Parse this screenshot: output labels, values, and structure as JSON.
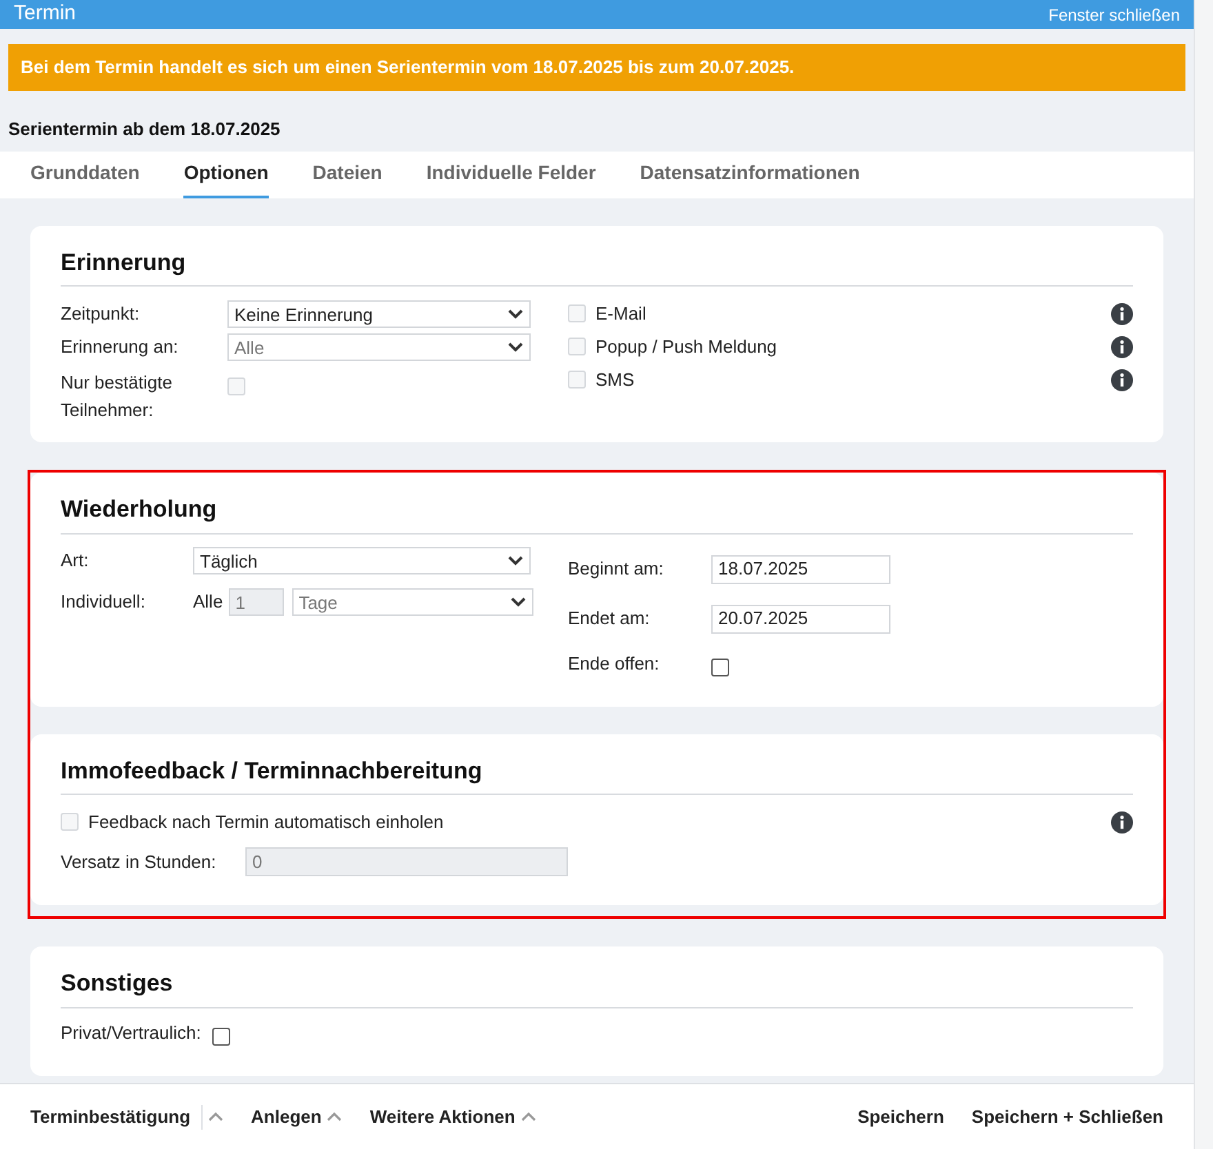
{
  "window": {
    "title": "Termin",
    "close_label": "Fenster schließen"
  },
  "banner": "Bei dem Termin handelt es sich um einen Serientermin vom 18.07.2025 bis zum 20.07.2025.",
  "heading": "Serientermin ab dem 18.07.2025",
  "tabs": [
    {
      "label": "Grunddaten",
      "selected": false
    },
    {
      "label": "Optionen",
      "selected": true
    },
    {
      "label": "Dateien",
      "selected": false
    },
    {
      "label": "Individuelle Felder",
      "selected": false
    },
    {
      "label": "Datensatzinformationen",
      "selected": false
    }
  ],
  "groups": [
    {
      "highlighted": false,
      "sections": [
        {
          "title": "Erinnerung",
          "left": [
            {
              "kind": "select",
              "label": "Zeitpunkt:",
              "value": "Keine Erinnerung",
              "disabled": false
            },
            {
              "kind": "select",
              "label": "Erinnerung an:",
              "value": "Alle",
              "disabled": true
            },
            {
              "kind": "checkbox",
              "label": "Nur bestätigte Teilnehmer:",
              "checked": false,
              "disabled": true
            }
          ],
          "right": [
            {
              "kind": "option",
              "label": "E-Mail",
              "checked": false,
              "disabled": true,
              "info": true
            },
            {
              "kind": "option",
              "label": "Popup / Push Meldung",
              "checked": false,
              "disabled": true,
              "info": true
            },
            {
              "kind": "option",
              "label": "SMS",
              "checked": false,
              "disabled": true,
              "info": true
            }
          ]
        }
      ]
    },
    {
      "highlighted": true,
      "sections": [
        {
          "title": "Wiederholung",
          "left": [
            {
              "kind": "select",
              "label": "Art:",
              "value": "Täglich",
              "disabled": false
            },
            {
              "kind": "interval",
              "label": "Individuell:",
              "prefix": "Alle",
              "count": "1",
              "unit": "Tage",
              "disabled": true
            }
          ],
          "right": [
            {
              "kind": "text",
              "label": "Beginnt am:",
              "value": "18.07.2025",
              "disabled": false
            },
            {
              "kind": "text",
              "label": "Endet am:",
              "value": "20.07.2025",
              "disabled": false
            },
            {
              "kind": "checkbox",
              "label": "Ende offen:",
              "checked": false,
              "disabled": false
            }
          ]
        },
        {
          "title": "Immofeedback / Terminnachbereitung",
          "left": [
            {
              "kind": "option",
              "label": "Feedback nach Termin automatisch einholen",
              "checked": false,
              "disabled": true,
              "info": true
            },
            {
              "kind": "text",
              "label": "Versatz in Stunden:",
              "value": "0",
              "disabled": true
            }
          ]
        }
      ]
    },
    {
      "highlighted": false,
      "sections": [
        {
          "title": "Sonstiges",
          "left": [
            {
              "kind": "checkbox",
              "label": "Privat/Vertraulich:",
              "checked": false,
              "disabled": false
            }
          ]
        }
      ]
    }
  ],
  "footer": {
    "left": [
      {
        "label": "Terminbestätigung",
        "divider": true
      },
      {
        "label": "Anlegen",
        "divider": false
      },
      {
        "label": "Weitere Aktionen",
        "divider": false
      }
    ],
    "right": [
      "Speichern",
      "Speichern + Schließen"
    ]
  }
}
